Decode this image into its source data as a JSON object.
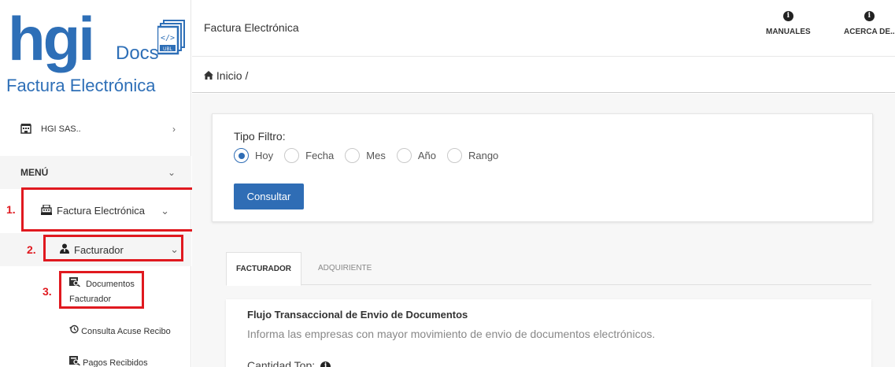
{
  "logo": {
    "main": "hgi",
    "docs": "Docs",
    "subtitle": "Factura Electrónica",
    "doc_icon_tag": "UBL",
    "doc_icon_code": "</>"
  },
  "sidebar": {
    "company": {
      "icon": "company-building-icon",
      "label": "HGI SAS..",
      "chevron": "›"
    },
    "menu": {
      "label": "MENÚ",
      "chevron": "⌄"
    },
    "factura_electronica": {
      "icon": "cash-register-icon",
      "label": "Factura Electrónica",
      "chevron": "⌄"
    },
    "facturador": {
      "icon": "user-tie-icon",
      "label": "Facturador",
      "chevron": "⌄"
    },
    "documentos_facturador": {
      "icon": "search-doc-icon",
      "label_line1": "Documentos",
      "label_line2": "Facturador"
    },
    "consulta_acuse": {
      "icon": "history-icon",
      "label": "Consulta Acuse Recibo"
    },
    "pagos_recibidos": {
      "icon": "search-doc-icon",
      "label": "Pagos Recibidos"
    }
  },
  "annotations": {
    "n1": "1.",
    "n2": "2.",
    "n3": "3.",
    "color": "#e0191f"
  },
  "topbar": {
    "title": "Factura Electrónica",
    "manuales": "MANUALES",
    "acerca": "ACERCA DE..",
    "info_glyph": "i"
  },
  "breadcrumb": {
    "home_icon": "home-icon",
    "text": "Inicio /"
  },
  "filter": {
    "title": "Tipo Filtro:",
    "options": [
      "Hoy",
      "Fecha",
      "Mes",
      "Año",
      "Rango"
    ],
    "selected": "Hoy",
    "button": "Consultar"
  },
  "tabs": {
    "active": "FACTURADOR",
    "inactive": "ADQUIRIENTE"
  },
  "content": {
    "title": "Flujo Transaccional de Envio de Documentos",
    "subtitle": "Informa las empresas con mayor movimiento de envio de documentos electrónicos.",
    "cantidad_top": "Cantidad Top:",
    "info_glyph": "i"
  },
  "colors": {
    "accent": "#2f6db5",
    "brand": "#2e6fb7"
  }
}
